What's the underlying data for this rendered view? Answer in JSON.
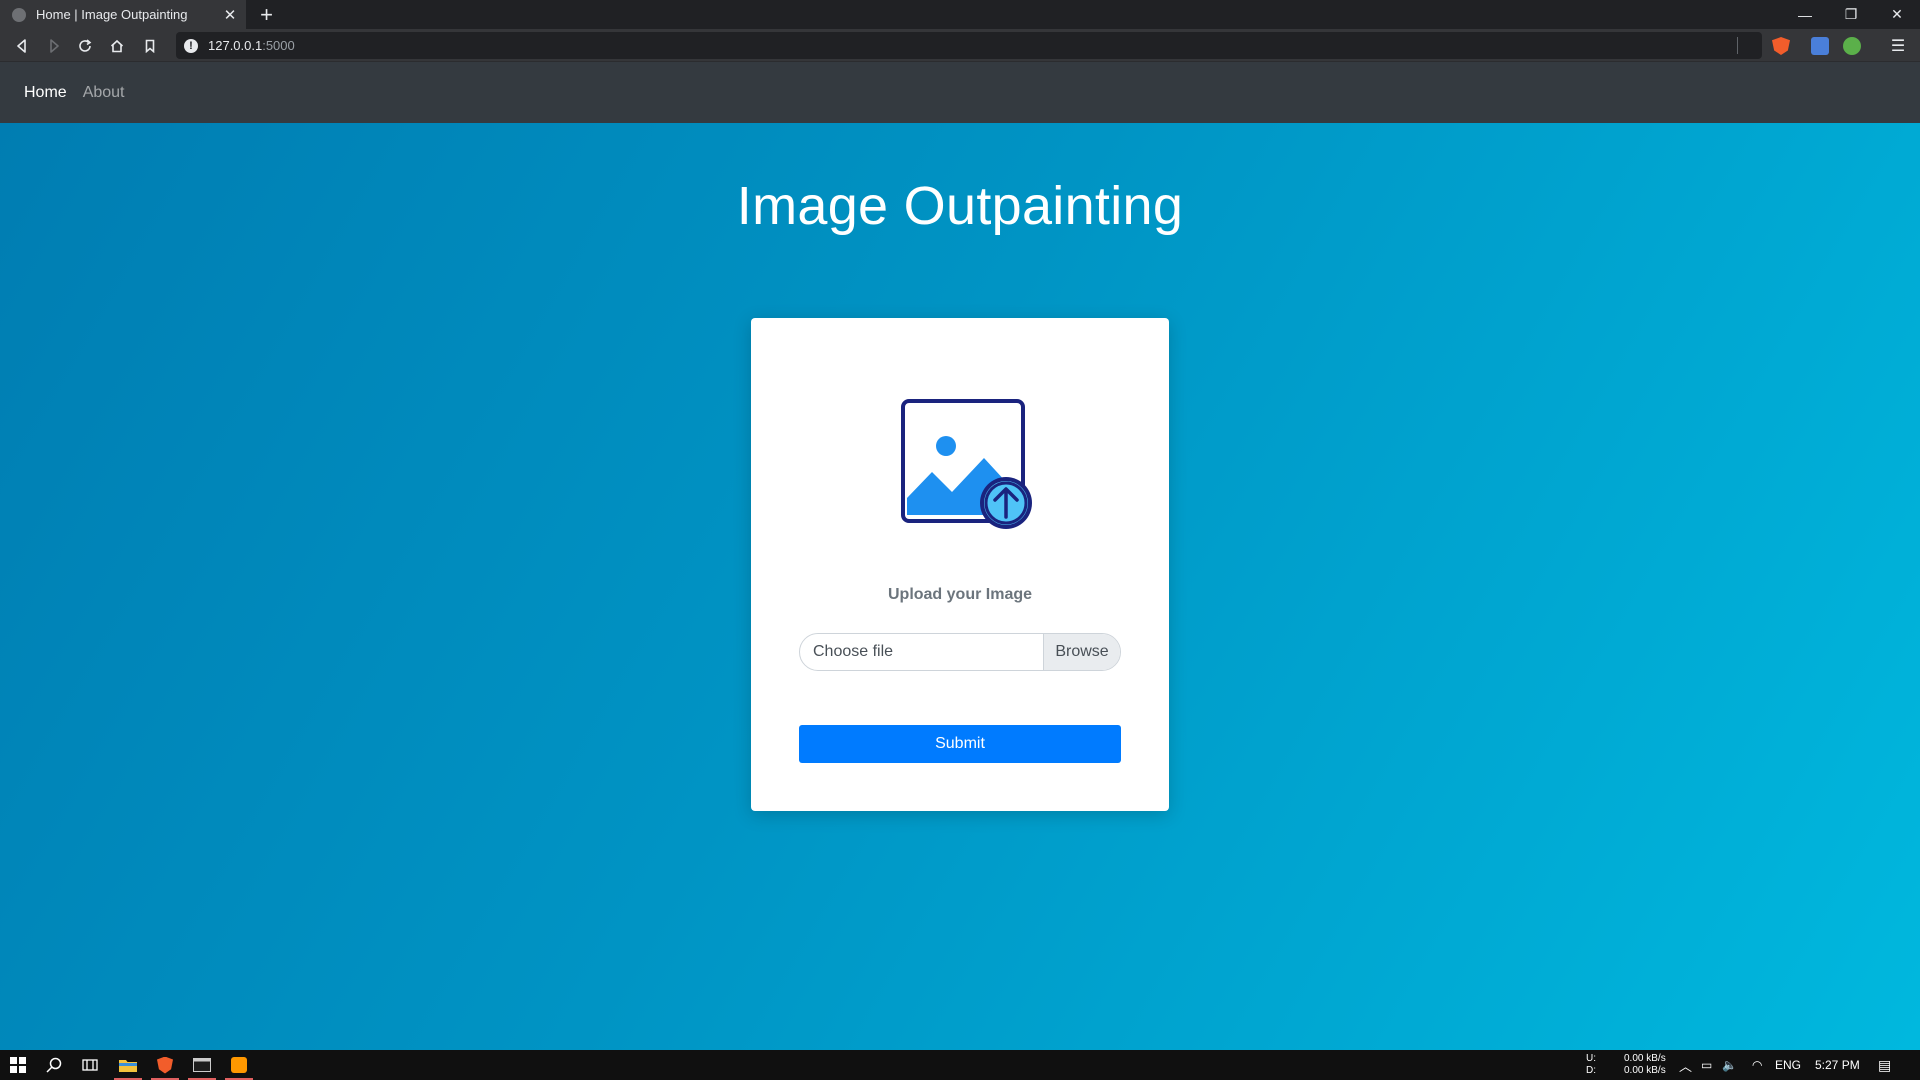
{
  "browser": {
    "tab_title": "Home | Image Outpainting",
    "tab_close_glyph": "✕",
    "new_tab_glyph": "+",
    "url_host": "127.0.0.1",
    "url_port": ":5000",
    "controls": {
      "minimize": "—",
      "restore": "❐",
      "close": "✕"
    }
  },
  "nav": {
    "links": [
      {
        "label": "Home",
        "active": true
      },
      {
        "label": "About",
        "active": false
      }
    ]
  },
  "main": {
    "title": "Image Outpainting",
    "upload_label": "Upload your Image",
    "file_input": {
      "placeholder": "Choose file",
      "browse_label": "Browse"
    },
    "submit_label": "Submit"
  },
  "taskbar": {
    "net_up_label": "U:",
    "net_down_label": "D:",
    "net_up_value": "0.00 kB/s",
    "net_down_value": "0.00 kB/s",
    "language": "ENG",
    "time": "5:27 PM"
  },
  "colors": {
    "accent_button": "#007bff",
    "navbar": "#343a40",
    "page_background": "#0097c4",
    "illustration_outline": "#1a237e",
    "illustration_fill": "#1e90f0",
    "upload_circle": "#4fc3f7"
  },
  "icons": [
    "back-arrow-icon",
    "forward-arrow-icon",
    "reload-icon",
    "home-icon",
    "bookmark-icon",
    "info-icon",
    "brave-lion-icon",
    "translate-icon",
    "extension-icon",
    "menu-icon",
    "image-upload-icon",
    "windows-start-icon",
    "search-icon",
    "task-view-icon",
    "file-explorer-icon",
    "brave-icon",
    "terminal-icon",
    "sublime-icon",
    "notification-icon"
  ]
}
